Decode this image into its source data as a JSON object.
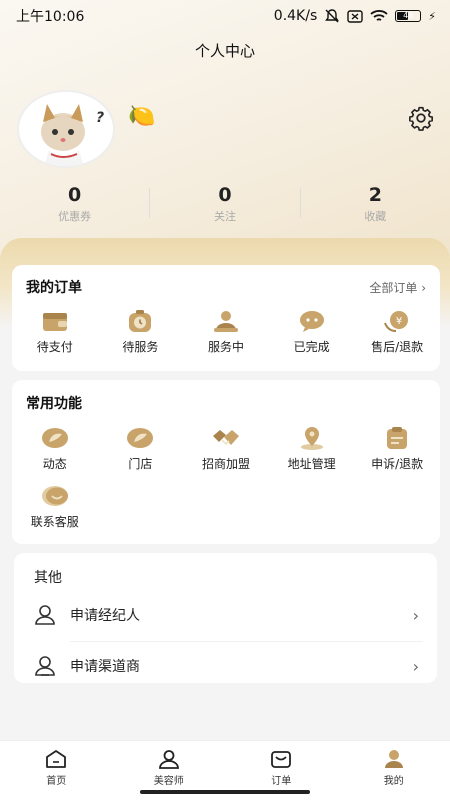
{
  "status_bar": {
    "time": "上午10:06",
    "speed": "0.4K/s",
    "battery": "46"
  },
  "header": {
    "title": "个人中心"
  },
  "profile": {
    "nickname_icon": "🍋",
    "avatar_alt": "cat-avatar"
  },
  "stats": [
    {
      "value": "0",
      "label": "优惠券"
    },
    {
      "value": "0",
      "label": "关注"
    },
    {
      "value": "2",
      "label": "收藏"
    }
  ],
  "orders": {
    "title": "我的订单",
    "all_label": "全部订单",
    "items": [
      {
        "label": "待支付",
        "icon": "wallet-icon"
      },
      {
        "label": "待服务",
        "icon": "clock-bag-icon"
      },
      {
        "label": "服务中",
        "icon": "service-person-icon"
      },
      {
        "label": "已完成",
        "icon": "chat-done-icon"
      },
      {
        "label": "售后/退款",
        "icon": "refund-icon"
      }
    ]
  },
  "features": {
    "title": "常用功能",
    "items": [
      {
        "label": "动态",
        "icon": "leaf-bubble-icon"
      },
      {
        "label": "门店",
        "icon": "leaf-bubble-icon"
      },
      {
        "label": "招商加盟",
        "icon": "handshake-icon"
      },
      {
        "label": "地址管理",
        "icon": "location-pin-icon"
      },
      {
        "label": "申诉/退款",
        "icon": "clipboard-icon"
      },
      {
        "label": "联系客服",
        "icon": "smile-bubble-icon"
      }
    ]
  },
  "others": {
    "title": "其他",
    "items": [
      {
        "label": "申请经纪人",
        "icon": "person-icon"
      },
      {
        "label": "申请渠道商",
        "icon": "person-outline-icon"
      }
    ]
  },
  "tabbar": [
    {
      "label": "首页",
      "icon": "home-icon"
    },
    {
      "label": "美容师",
      "icon": "beautician-icon"
    },
    {
      "label": "订单",
      "icon": "order-icon"
    },
    {
      "label": "我的",
      "icon": "mine-icon"
    }
  ],
  "colors": {
    "accent_gold": "#c8a46a",
    "icon_brown": "#9a7a4a"
  }
}
